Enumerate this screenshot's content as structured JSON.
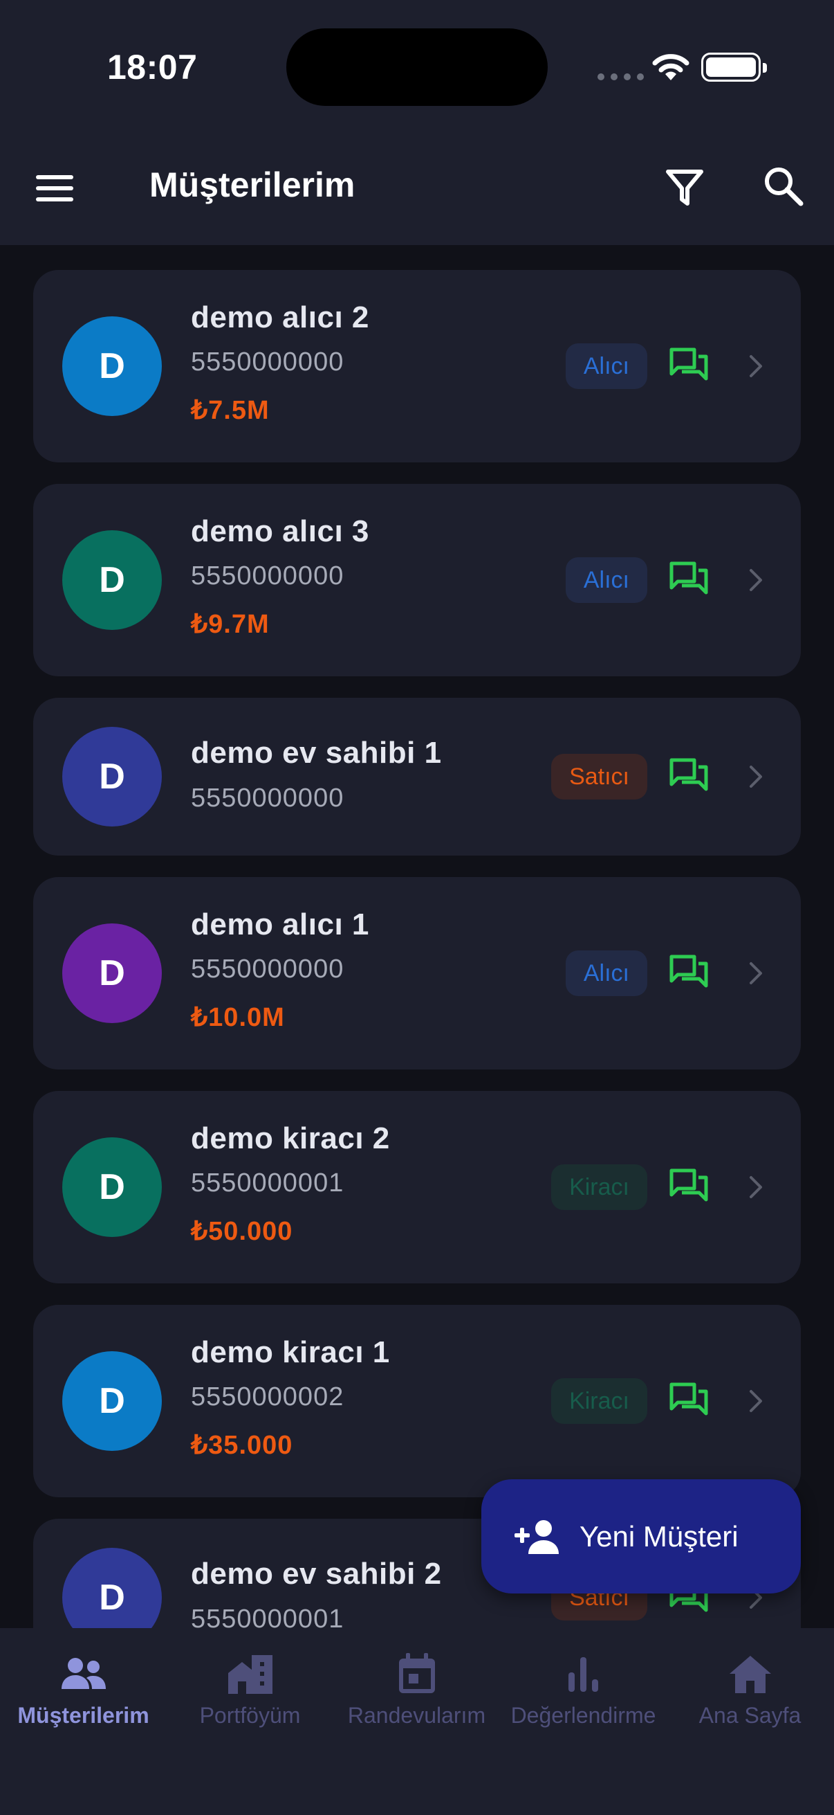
{
  "status_bar": {
    "time": "18:07"
  },
  "app_bar": {
    "title": "Müşterilerim",
    "icons": [
      "menu-icon",
      "filter-icon",
      "search-icon"
    ]
  },
  "customers": [
    {
      "initial": "D",
      "name": "demo alıcı 2",
      "phone": "5550000000",
      "price": "₺7.5M",
      "tag": "Alıcı",
      "tag_type": "buyer",
      "avatar_color": "#0b7bc6"
    },
    {
      "initial": "D",
      "name": "demo alıcı 3",
      "phone": "5550000000",
      "price": "₺9.7M",
      "tag": "Alıcı",
      "tag_type": "buyer",
      "avatar_color": "#08705f"
    },
    {
      "initial": "D",
      "name": "demo ev sahibi 1",
      "phone": "5550000000",
      "price": "",
      "tag": "Satıcı",
      "tag_type": "seller",
      "avatar_color": "#303a98"
    },
    {
      "initial": "D",
      "name": "demo alıcı 1",
      "phone": "5550000000",
      "price": "₺10.0M",
      "tag": "Alıcı",
      "tag_type": "buyer",
      "avatar_color": "#6a22a3"
    },
    {
      "initial": "D",
      "name": "demo kiracı 2",
      "phone": "5550000001",
      "price": "₺50.000",
      "tag": "Kiracı",
      "tag_type": "tenant",
      "avatar_color": "#08705f"
    },
    {
      "initial": "D",
      "name": "demo kiracı 1",
      "phone": "5550000002",
      "price": "₺35.000",
      "tag": "Kiracı",
      "tag_type": "tenant",
      "avatar_color": "#0b7bc6"
    },
    {
      "initial": "D",
      "name": "demo ev sahibi 2",
      "phone": "5550000001",
      "price": "",
      "tag": "Satıcı",
      "tag_type": "seller",
      "avatar_color": "#303a98"
    }
  ],
  "fab": {
    "label": "Yeni Müşteri",
    "icon": "person-add-icon"
  },
  "bottom_nav": [
    {
      "label": "Müşterilerim",
      "icon": "people-icon",
      "active": true
    },
    {
      "label": "Portföyüm",
      "icon": "buildings-icon",
      "active": false
    },
    {
      "label": "Randevularım",
      "icon": "calendar-icon",
      "active": false
    },
    {
      "label": "Değerlendirme",
      "icon": "bar-chart-icon",
      "active": false
    },
    {
      "label": "Ana Sayfa",
      "icon": "home-icon",
      "active": false
    }
  ],
  "colors": {
    "background": "#101118",
    "surface": "#1d1f2d",
    "price": "#ee5a12",
    "chat": "#2ecc52",
    "fab": "#1d2386",
    "nav_active": "#8f94dc",
    "nav_inactive": "#4e4f7a"
  }
}
